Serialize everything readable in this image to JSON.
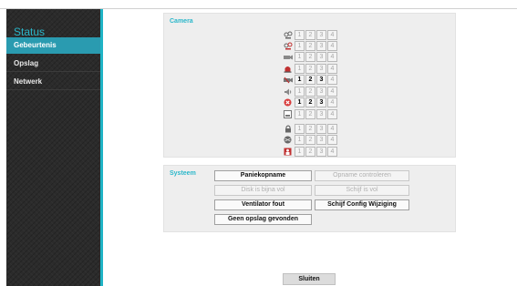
{
  "sidebar": {
    "title": "Status",
    "items": [
      {
        "label": "Gebeurtenis",
        "active": true
      },
      {
        "label": "Opslag",
        "active": false
      },
      {
        "label": "Netwerk",
        "active": false
      }
    ]
  },
  "camera": {
    "title": "Camera",
    "channels": [
      "1",
      "2",
      "3",
      "4"
    ],
    "rows": [
      {
        "icon": "alarm-in-icon",
        "active": [
          false,
          false,
          false,
          false
        ]
      },
      {
        "icon": "alarm-in-alert-icon",
        "active": [
          false,
          false,
          false,
          false
        ]
      },
      {
        "icon": "camera-icon",
        "active": [
          false,
          false,
          false,
          false
        ]
      },
      {
        "icon": "siren-icon",
        "active": [
          false,
          false,
          false,
          false
        ]
      },
      {
        "icon": "video-loss-icon",
        "active": [
          true,
          true,
          true,
          false
        ]
      },
      {
        "icon": "speaker-icon",
        "active": [
          false,
          false,
          false,
          false
        ]
      },
      {
        "icon": "stop-icon",
        "active": [
          true,
          true,
          true,
          false
        ]
      },
      {
        "icon": "disk-icon",
        "active": [
          false,
          false,
          false,
          false
        ]
      },
      {
        "icon": "lock-icon",
        "active": [
          false,
          false,
          false,
          false
        ]
      },
      {
        "icon": "tamper-icon",
        "active": [
          false,
          false,
          false,
          false
        ]
      },
      {
        "icon": "person-icon",
        "active": [
          false,
          false,
          false,
          false
        ]
      }
    ]
  },
  "system": {
    "title": "Systeem",
    "buttons": [
      {
        "label": "Paniekopname",
        "enabled": true
      },
      {
        "label": "Opname controleren",
        "enabled": false
      },
      {
        "label": "Disk is bijna vol",
        "enabled": false
      },
      {
        "label": "Schijf is vol",
        "enabled": false
      },
      {
        "label": "Ventilator fout",
        "enabled": true
      },
      {
        "label": "Schijf Config Wijziging",
        "enabled": true
      },
      {
        "label": "Geen opslag gevonden",
        "enabled": true
      }
    ]
  },
  "footer": {
    "close_label": "Sluiten"
  }
}
